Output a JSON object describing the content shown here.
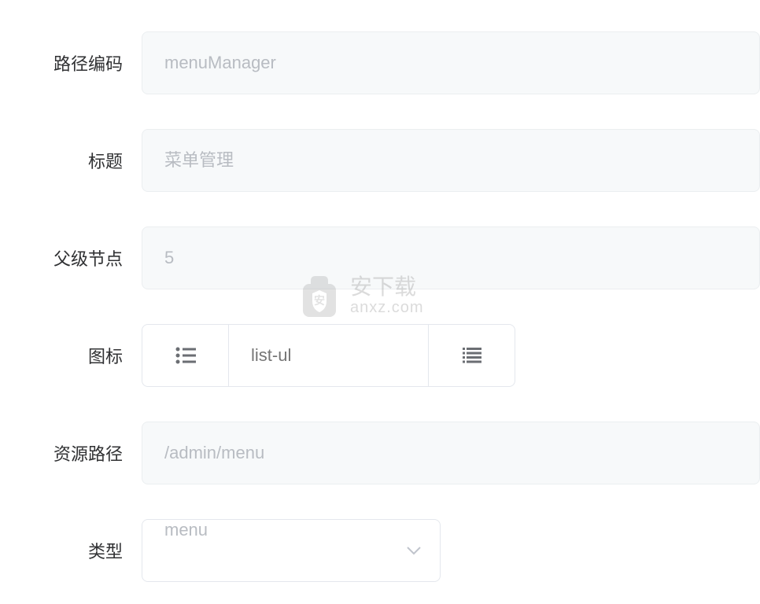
{
  "form": {
    "pathCode": {
      "label": "路径编码",
      "placeholder": "menuManager",
      "value": ""
    },
    "title": {
      "label": "标题",
      "placeholder": "菜单管理",
      "value": ""
    },
    "parentNode": {
      "label": "父级节点",
      "placeholder": "5",
      "value": ""
    },
    "icon": {
      "label": "图标",
      "placeholder": "list-ul",
      "value": ""
    },
    "resourcePath": {
      "label": "资源路径",
      "placeholder": "/admin/menu",
      "value": ""
    },
    "type": {
      "label": "类型",
      "selected": "menu"
    }
  },
  "watermark": {
    "cn": "安下载",
    "en": "anxz.com"
  }
}
